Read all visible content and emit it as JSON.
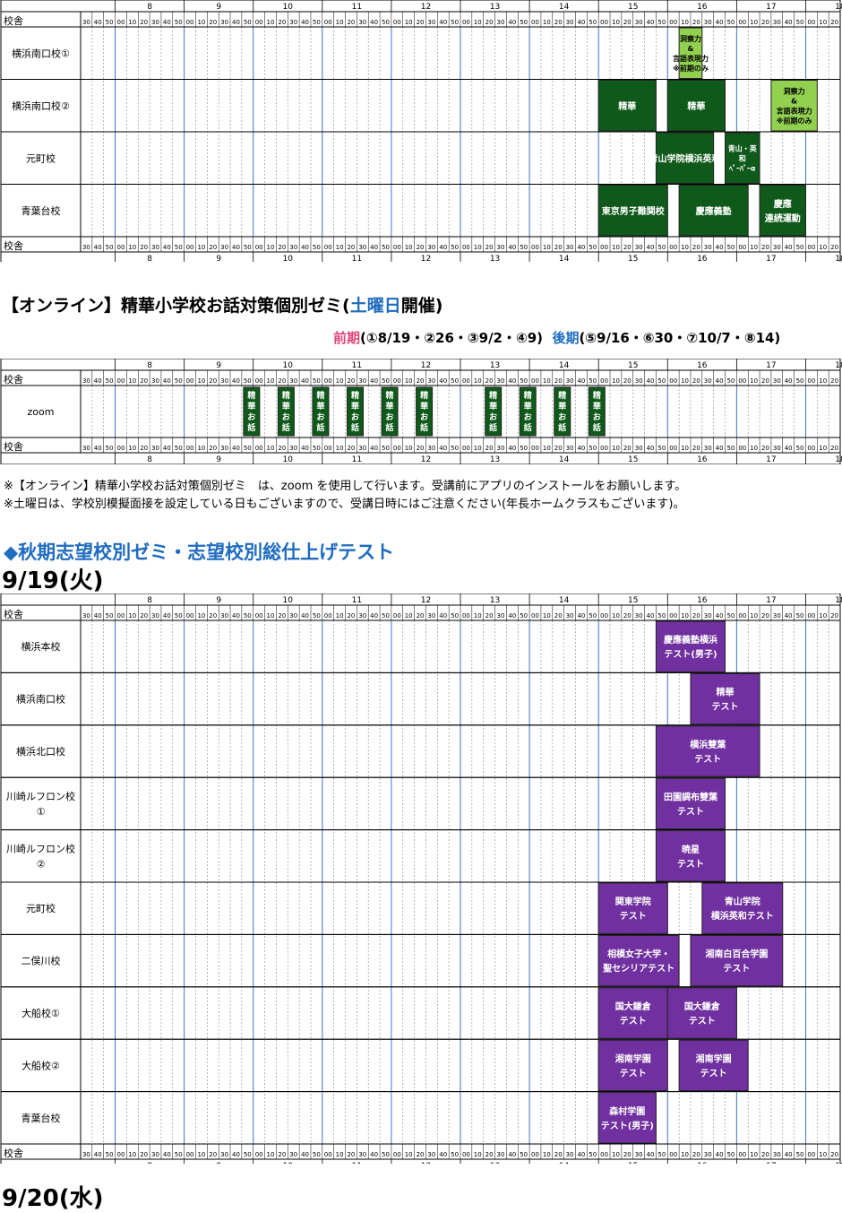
{
  "colors": {
    "green_dark": "#0f5a1a",
    "green_light": "#92d050",
    "purple": "#7030a0",
    "pink": "#e0447a",
    "blue_link": "#1f6cc0",
    "hour_line": "#4472c4",
    "tick_line": "#888888"
  },
  "hours": [
    "8",
    "9",
    "10",
    "11",
    "12",
    "13",
    "14",
    "15",
    "16",
    "17",
    "18",
    "19"
  ],
  "minutes": [
    "30",
    "40",
    "50",
    "00",
    "10",
    "20",
    "30",
    "40",
    "50",
    "00",
    "10",
    "20",
    "30",
    "40",
    "50",
    "00",
    "10",
    "20",
    "30",
    "40",
    "50",
    "00",
    "10",
    "20",
    "30",
    "40",
    "50",
    "00",
    "10",
    "20",
    "30",
    "40",
    "50",
    "00",
    "10",
    "20",
    "30",
    "40",
    "50",
    "00",
    "10",
    "20",
    "30",
    "40",
    "50",
    "00",
    "10",
    "20",
    "30",
    "40",
    "50",
    "00",
    "10",
    "20",
    "30",
    "40",
    "50",
    "00",
    "10",
    "20",
    "30",
    "40",
    "50",
    "00",
    "10",
    "20"
  ],
  "header_label": "校舎",
  "schedule1": {
    "rows": [
      "横浜南口校①",
      "横浜南口校②",
      "元町校",
      "青葉台校"
    ],
    "events": [
      {
        "row": 0,
        "start": "16:10",
        "end": "16:30",
        "color": "green_light",
        "lines": [
          "洞察力",
          "&",
          "言語表現力",
          "※前期のみ"
        ]
      },
      {
        "row": 1,
        "start": "15:00",
        "end": "15:50",
        "color": "green_dark",
        "lines": [
          "精華"
        ]
      },
      {
        "row": 1,
        "start": "16:00",
        "end": "16:50",
        "color": "green_dark",
        "lines": [
          "精華"
        ]
      },
      {
        "row": 1,
        "start": "17:30",
        "end": "18:10",
        "color": "green_light",
        "lines": [
          "洞察力",
          "&",
          "言語表現力",
          "※前期のみ"
        ]
      },
      {
        "row": 2,
        "start": "15:50",
        "end": "16:40",
        "color": "green_dark",
        "lines": [
          "青山学院横浜英和"
        ]
      },
      {
        "row": 2,
        "start": "16:50",
        "end": "17:20",
        "color": "green_dark",
        "lines": [
          "青山・英",
          "和",
          "ﾍﾟｰﾊﾟｰα"
        ]
      },
      {
        "row": 3,
        "start": "15:00",
        "end": "16:00",
        "color": "green_dark",
        "lines": [
          "東京男子難関校"
        ]
      },
      {
        "row": 3,
        "start": "16:10",
        "end": "17:10",
        "color": "green_dark",
        "lines": [
          "慶應義塾"
        ]
      },
      {
        "row": 3,
        "start": "17:20",
        "end": "18:00",
        "color": "green_dark",
        "lines": [
          "慶應",
          "連続運動"
        ]
      }
    ]
  },
  "online": {
    "title_main": "【オンライン】精華小学校お話対策個別ゼミ(",
    "title_day": "土曜日",
    "title_tail": "開催)",
    "zenki_label": "前期",
    "zenki_dates": "(①8/19・②26・③9/2・④9)",
    "kouki_label": "後期",
    "kouki_dates": "(⑤9/16・⑥30・⑦10/7・⑧14)",
    "rows": [
      "zoom"
    ],
    "slot_text": [
      "精",
      "華",
      "お",
      "話"
    ],
    "slots": [
      "9:50",
      "10:20",
      "10:50",
      "11:20",
      "11:50",
      "12:20",
      "13:20",
      "13:50",
      "14:20",
      "14:50"
    ]
  },
  "notes": [
    "※【オンライン】精華小学校お話対策個別ゼミ　は、zoom を使用して行います。受講前にアプリのインストールをお願いします。",
    "※土曜日は、学校別模擬面接を設定している日もございますので、受講日時にはご注意ください(年長ホームクラスもございます)。"
  ],
  "autumn_title": "◆秋期志望校別ゼミ・志望校別総仕上げテスト",
  "date1": "9/19(火)",
  "date2": "9/20(水)",
  "schedule2": {
    "rows": [
      "横浜本校",
      "横浜南口校",
      "横浜北口校",
      "川崎ルフロン校\n①",
      "川崎ルフロン校\n②",
      "元町校",
      "二俣川校",
      "大船校①",
      "大船校②",
      "青葉台校"
    ],
    "events": [
      {
        "row": 0,
        "start": "15:50",
        "end": "16:50",
        "color": "purple",
        "lines": [
          "慶應義塾横浜",
          "テスト(男子)"
        ]
      },
      {
        "row": 1,
        "start": "16:20",
        "end": "17:20",
        "color": "purple",
        "lines": [
          "精華",
          "テスト"
        ]
      },
      {
        "row": 2,
        "start": "15:50",
        "end": "17:20",
        "color": "purple",
        "lines": [
          "横浜雙葉",
          "テスト"
        ]
      },
      {
        "row": 3,
        "start": "15:50",
        "end": "16:50",
        "color": "purple",
        "lines": [
          "田園調布雙葉",
          "テスト"
        ]
      },
      {
        "row": 4,
        "start": "15:50",
        "end": "16:50",
        "color": "purple",
        "lines": [
          "暁星",
          "テスト"
        ]
      },
      {
        "row": 5,
        "start": "15:00",
        "end": "16:00",
        "color": "purple",
        "lines": [
          "関東学院",
          "テスト"
        ]
      },
      {
        "row": 5,
        "start": "16:30",
        "end": "17:40",
        "color": "purple",
        "lines": [
          "青山学院",
          "横浜英和テスト"
        ]
      },
      {
        "row": 6,
        "start": "15:00",
        "end": "16:10",
        "color": "purple",
        "lines": [
          "相模女子大学・",
          "聖セシリアテスト"
        ]
      },
      {
        "row": 6,
        "start": "16:20",
        "end": "17:40",
        "color": "purple",
        "lines": [
          "湘南白百合学園",
          "テスト"
        ]
      },
      {
        "row": 7,
        "start": "15:00",
        "end": "16:00",
        "color": "purple",
        "lines": [
          "国大鎌倉",
          "テスト"
        ]
      },
      {
        "row": 7,
        "start": "16:00",
        "end": "17:00",
        "color": "purple",
        "lines": [
          "国大鎌倉",
          "テスト"
        ]
      },
      {
        "row": 8,
        "start": "15:00",
        "end": "16:00",
        "color": "purple",
        "lines": [
          "湘南学園",
          "テスト"
        ]
      },
      {
        "row": 8,
        "start": "16:10",
        "end": "17:10",
        "color": "purple",
        "lines": [
          "湘南学園",
          "テスト"
        ]
      },
      {
        "row": 9,
        "start": "15:00",
        "end": "15:50",
        "color": "purple",
        "lines": [
          "森村学園",
          "テスト(男子)"
        ]
      }
    ]
  }
}
